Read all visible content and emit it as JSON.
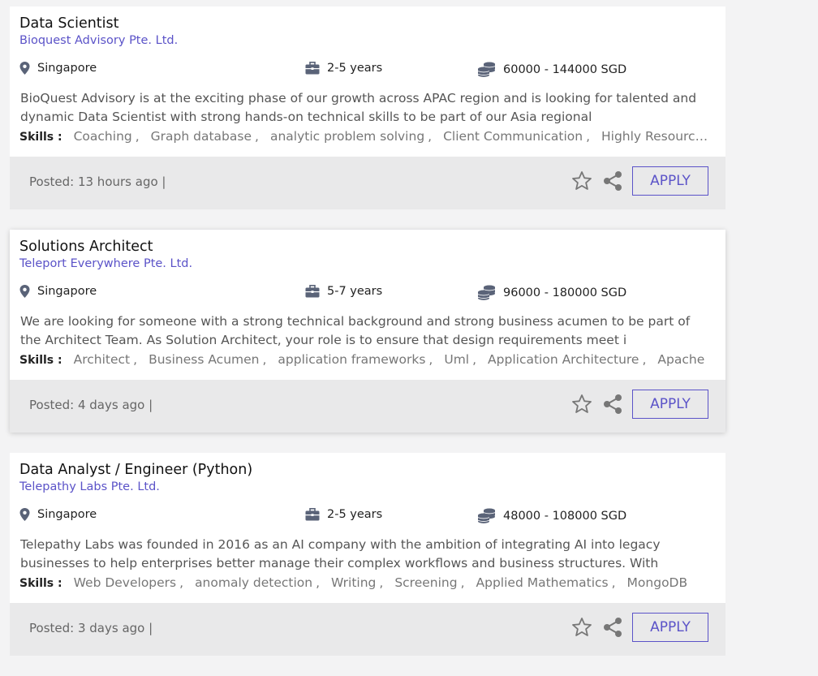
{
  "jobs": [
    {
      "title": "Data Scientist",
      "company": "Bioquest Advisory Pte. Ltd.",
      "location": "Singapore",
      "experience": "2-5 years",
      "salary": "60000 - 144000 SGD",
      "description": "BioQuest Advisory is at the exciting phase of our growth across APAC region and is looking for talented and dynamic Data Scientist with strong hands-on technical skills to be part of our Asia regional",
      "skills_label": "Skills :",
      "skills": [
        "Coaching",
        "Graph database",
        "analytic problem solving",
        "Client Communication",
        "Highly Resourceful"
      ],
      "posted": "Posted: 13 hours ago |",
      "apply_label": "APPLY"
    },
    {
      "title": "Solutions Architect",
      "company": "Teleport Everywhere Pte. Ltd.",
      "location": "Singapore",
      "experience": "5-7 years",
      "salary": "96000 - 180000 SGD",
      "description": "We are looking for someone with a strong technical background and strong business acumen to be part of the Architect Team. As Solution Architect, your role is to ensure that design requirements meet i",
      "skills_label": "Skills :",
      "skills": [
        "Architect",
        "Business Acumen",
        "application frameworks",
        "Uml",
        "Application Architecture",
        "Apache"
      ],
      "posted": "Posted: 4 days ago |",
      "apply_label": "APPLY"
    },
    {
      "title": "Data Analyst / Engineer (Python)",
      "company": "Telepathy Labs Pte. Ltd.",
      "location": "Singapore",
      "experience": "2-5 years",
      "salary": "48000 - 108000 SGD",
      "description": "Telepathy Labs was founded in 2016 as an AI company with the ambition of integrating AI into legacy businesses to help enterprises better manage their complex workflows and business structures. With",
      "skills_label": "Skills :",
      "skills": [
        "Web Developers",
        "anomaly detection",
        "Writing",
        "Screening",
        "Applied Mathematics",
        "MongoDB"
      ],
      "posted": "Posted: 3 days ago |",
      "apply_label": "APPLY"
    }
  ],
  "icons": {
    "location": "location-pin-icon",
    "experience": "briefcase-icon",
    "salary": "coins-stack-icon",
    "favorite": "star-icon",
    "share": "share-icon"
  },
  "colors": {
    "accent": "#5b53c8",
    "icon": "#5a6378",
    "footer": "#e9e9ea"
  }
}
